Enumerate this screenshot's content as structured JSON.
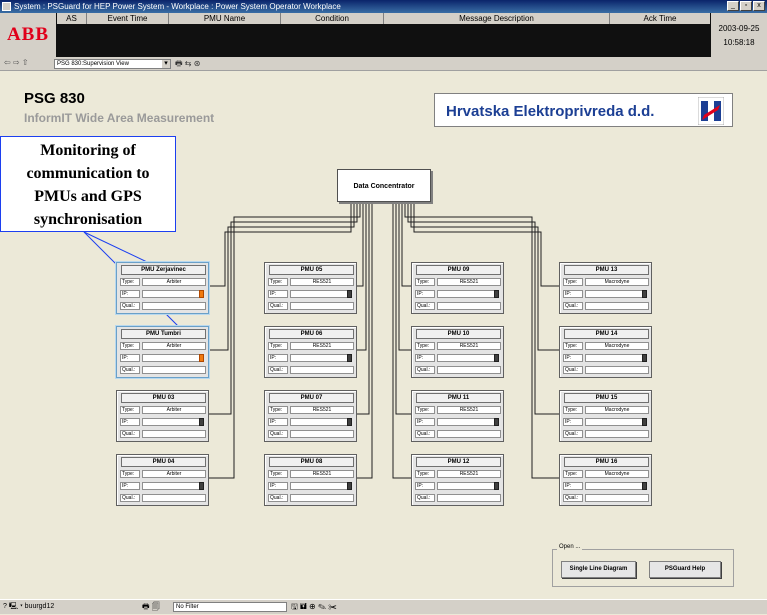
{
  "window": {
    "title": "System : PSGuard for HEP Power System - Workplace : Power System Operator Workplace",
    "buttons": [
      "_",
      "▫",
      "x"
    ]
  },
  "alarm_bar": {
    "logo": "ABB",
    "columns": [
      "AS",
      "Event Time",
      "PMU Name",
      "Condition",
      "Message Description",
      "Ack Time"
    ],
    "date": "2003-09-25",
    "time": "10:58:18"
  },
  "nav": {
    "arrows": "⇦ ⇨ ⇧",
    "view": "PSG 830:Supervision View",
    "tools": "🖶 ⇆ ⊛"
  },
  "main": {
    "title": "PSG 830",
    "subtitle": "InformIT Wide Area Measurement",
    "company": "Hrvatska Elektroprivreda d.d.",
    "callout": [
      "Monitoring of",
      "communication to",
      "PMUs and GPS",
      "synchronisation"
    ],
    "concentrator": "Data Concentrator",
    "labels": {
      "type": "Type:",
      "ip": "IP:",
      "qual": "Qual.:"
    },
    "pmus": [
      {
        "name": "PMU Zerjavinec",
        "type": "Arbiter",
        "status": "orange"
      },
      {
        "name": "PMU Tumbri",
        "type": "Arbiter",
        "status": "orange"
      },
      {
        "name": "PMU 03",
        "type": "Arbiter",
        "status": "dark"
      },
      {
        "name": "PMU 04",
        "type": "Arbiter",
        "status": "dark"
      },
      {
        "name": "PMU 05",
        "type": "RES521",
        "status": "dark"
      },
      {
        "name": "PMU 06",
        "type": "RES521",
        "status": "dark"
      },
      {
        "name": "PMU 07",
        "type": "RES521",
        "status": "dark"
      },
      {
        "name": "PMU 08",
        "type": "RES521",
        "status": "dark"
      },
      {
        "name": "PMU 09",
        "type": "RES521",
        "status": "dark"
      },
      {
        "name": "PMU 10",
        "type": "RES521",
        "status": "dark"
      },
      {
        "name": "PMU 11",
        "type": "RES521",
        "status": "dark"
      },
      {
        "name": "PMU 12",
        "type": "RES521",
        "status": "dark"
      },
      {
        "name": "PMU 13",
        "type": "Macrodyne",
        "status": "dark"
      },
      {
        "name": "PMU 14",
        "type": "Macrodyne",
        "status": "dark"
      },
      {
        "name": "PMU 15",
        "type": "Macrodyne",
        "status": "dark"
      },
      {
        "name": "PMU 16",
        "type": "Macrodyne",
        "status": "dark"
      }
    ],
    "open_group": {
      "legend": "Open ...",
      "single_line": "Single Line Diagram",
      "help": "PSGuard Help"
    }
  },
  "status_bar": {
    "user": "? 🖳 ▾ buurgd12",
    "filter": "No Filter",
    "icons": "🖶 🗐",
    "icons2": "🖫 🖬 ⊕ ✎ ✂"
  },
  "colors": {
    "callout_border": "#1c3ff0",
    "alarm_orange": "#f07a10",
    "company_blue": "#1c3f94",
    "logo_red": "#e0001a"
  }
}
